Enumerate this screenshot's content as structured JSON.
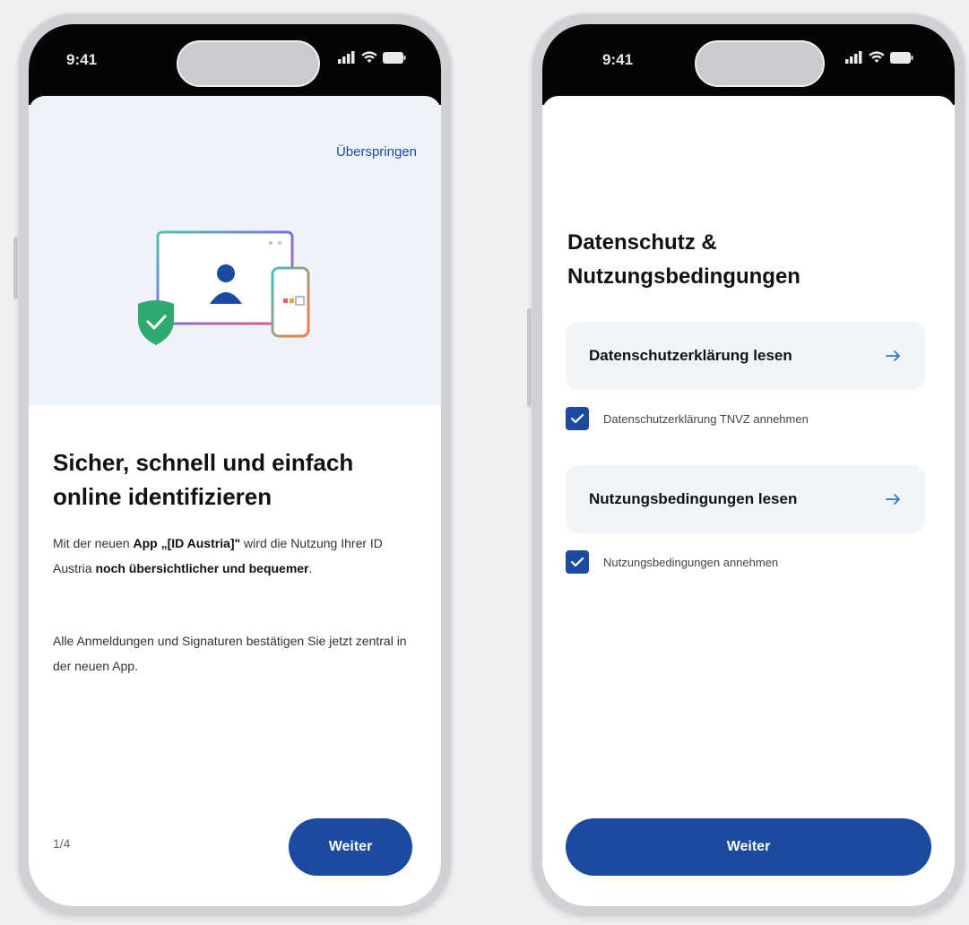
{
  "screens": [
    {
      "status_time": "9:41",
      "skip_label": "Überspringen",
      "headline": "Sicher, schnell und einfach online identifizieren",
      "paragraph1": {
        "t1": "Mit der neuen ",
        "b1": "App „[ID Austria]\"",
        "t2": " wird die Nutzung Ihrer ID Austria ",
        "b2": "noch übersichtlicher und bequemer",
        "t3": "."
      },
      "paragraph2": "Alle Anmeldungen und Signaturen bestätigen Sie jetzt zentral in der neuen App.",
      "pager": "1/4",
      "next_label": "Weiter"
    },
    {
      "status_time": "9:41",
      "title": "Datenschutz & Nutzungsbedingungen",
      "privacy_link": "Datenschutzerklärung lesen",
      "privacy_accept": "Datenschutzerklärung TNVZ annehmen",
      "privacy_checked": true,
      "terms_link": "Nutzungsbedingungen lesen",
      "terms_accept": "Nutzungsbedingungen annehmen",
      "terms_checked": true,
      "next_label": "Weiter"
    }
  ],
  "icons": {
    "hero": "identity-illustration",
    "arrow": "arrow-right-icon",
    "check": "check-icon",
    "signal": "cellular-signal-icon",
    "wifi": "wifi-icon",
    "battery": "battery-icon"
  },
  "colors": {
    "primary": "#1c4a9e",
    "link": "#1f4aa0",
    "hero_bg": "#eef3fa",
    "card_bg": "#f1f5fa"
  }
}
